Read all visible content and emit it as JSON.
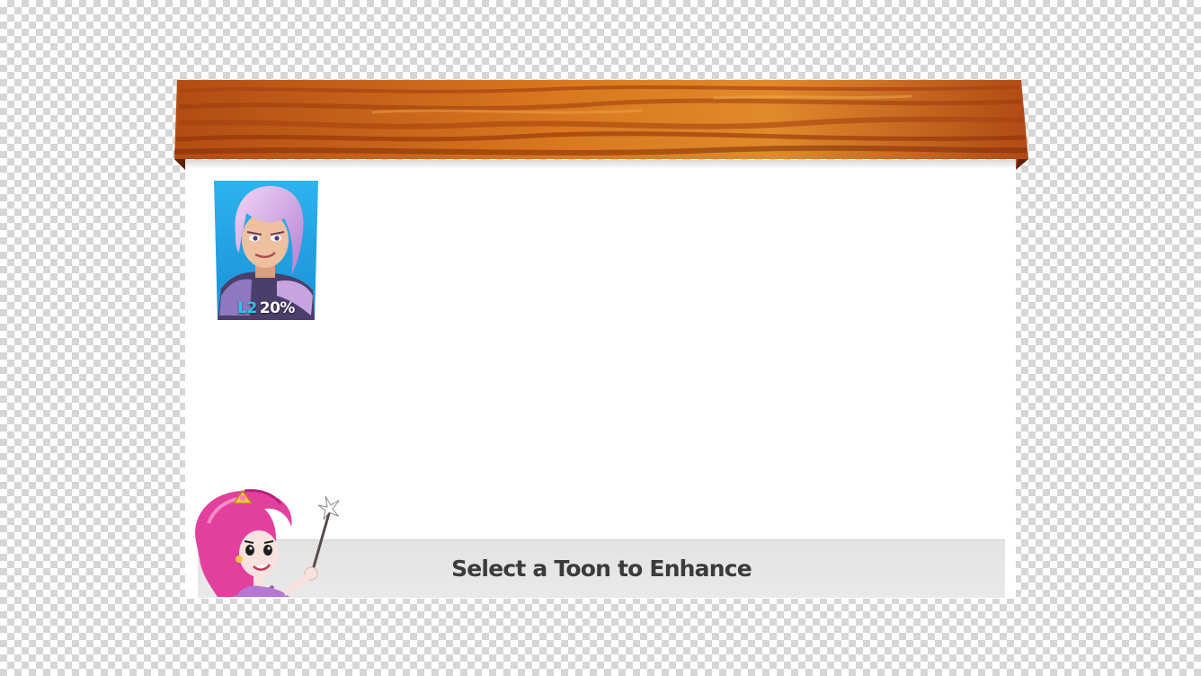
{
  "header": {
    "plank_color": "#c8621e",
    "plank_highlight": "#e39033",
    "plank_shadow": "#8a3510"
  },
  "roster": {
    "cards": [
      {
        "portrait": "purple-haired-hero-portrait",
        "level": "L2",
        "progress": "20%",
        "card_bg": "#1fa6e8"
      }
    ]
  },
  "prompt": {
    "text": "Select a Toon to Enhance"
  },
  "mascot": {
    "icon": "pink-fairy-with-wand"
  }
}
